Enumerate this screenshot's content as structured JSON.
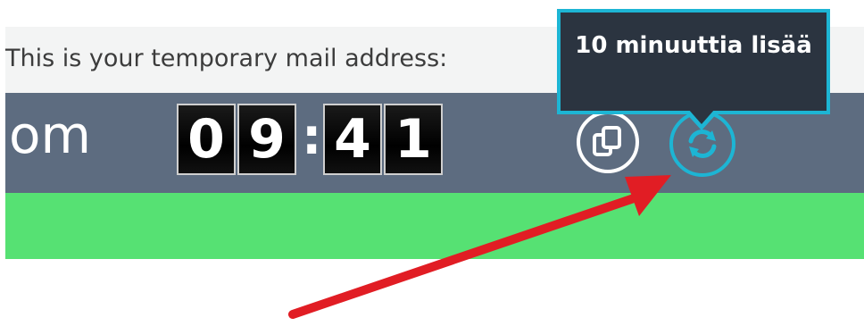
{
  "mail_label": "This is your temporary mail address:",
  "email_fragment": "om",
  "timer": {
    "d1": "0",
    "d2": "9",
    "separator": ":",
    "d3": "4",
    "d4": "1"
  },
  "tooltip_text": "10 minuuttia lisää",
  "icons": {
    "copy": "copy-icon",
    "refresh": "refresh-icon"
  },
  "colors": {
    "header_bar": "#5d6c80",
    "accent": "#1db5d4",
    "green_bar": "#56e173",
    "tooltip_bg": "#2b3440",
    "annotation_arrow": "#e11d24"
  }
}
